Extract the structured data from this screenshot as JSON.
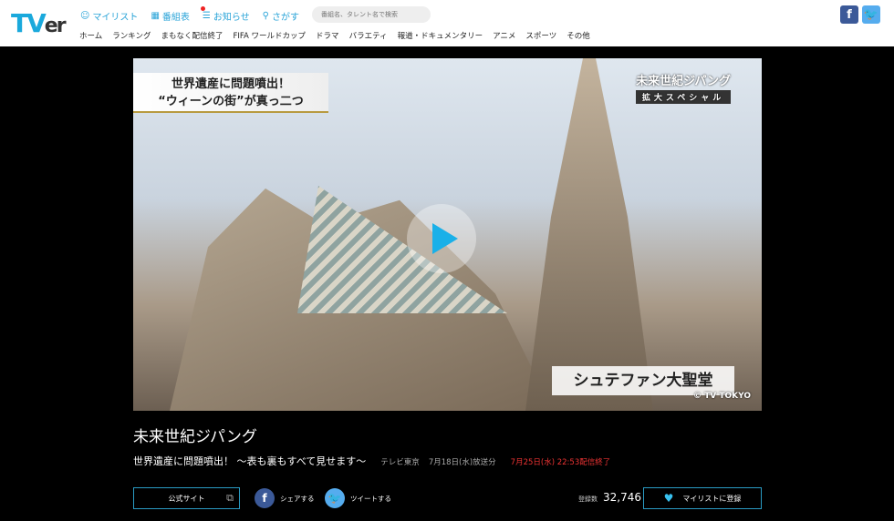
{
  "header": {
    "logo": "TVer",
    "top_links": [
      {
        "label": "マイリスト",
        "icon": "user-icon"
      },
      {
        "label": "番組表",
        "icon": "grid-icon"
      },
      {
        "label": "お知らせ",
        "icon": "list-icon"
      },
      {
        "label": "さがす",
        "icon": "search-icon"
      }
    ],
    "search_placeholder": "番組名、タレント名で検索",
    "nav": [
      "ホーム",
      "ランキング",
      "まもなく配信終了",
      "FIFA ワールドカップ",
      "ドラマ",
      "バラエティ",
      "報道・ドキュメンタリー",
      "アニメ",
      "スポーツ",
      "その他"
    ],
    "facebook": "f",
    "twitter": "t"
  },
  "video": {
    "caption_top_left_1": "世界遺産に問題噴出！",
    "caption_top_left_2": "“ウィーンの街”が真っ二つ",
    "caption_logo": "未来世紀ジパング",
    "caption_logo_sub": "拡大スペシャル",
    "caption_location": "シュテファン大聖堂",
    "copyright": "© TV TOKYO"
  },
  "program": {
    "title": "未来世紀ジパング",
    "episode": "世界遺産に問題噴出！ ～表も裏もすべて見せます～",
    "broadcaster": "テレビ東京",
    "aired": "7月18日(水)放送分",
    "end": "7月25日(水) 22:53配信終了"
  },
  "actions": {
    "official_site": "公式サイト",
    "share": "シェアする",
    "tweet": "ツイートする",
    "count_label": "登録数",
    "count": "32,746",
    "mylist": "マイリストに登録"
  },
  "colors": {
    "accent": "#1aa9dc",
    "end": "#e33333",
    "facebook": "#3b5998",
    "twitter": "#55acee"
  }
}
